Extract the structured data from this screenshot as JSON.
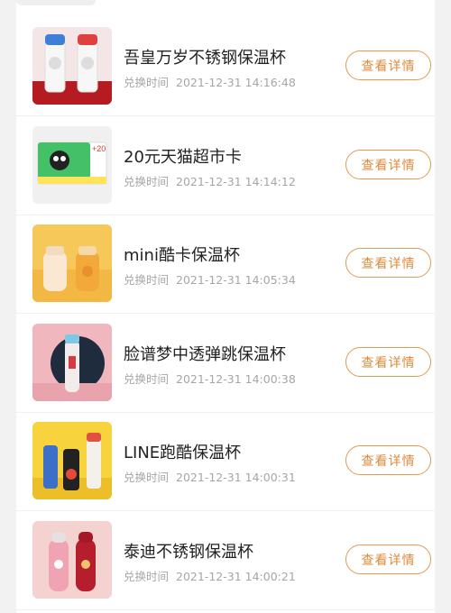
{
  "colors": {
    "accent": "#e09a52",
    "title": "#222222",
    "muted": "#a6a6a6"
  },
  "items": [
    {
      "title": "吾皇万岁不锈钢保温杯",
      "time_label": "兑换时间",
      "time": "2021-12-31 14:16:48",
      "button": "查看详情",
      "image_icon": "cat-thermos-image"
    },
    {
      "title": "20元天猫超市卡",
      "time_label": "兑换时间",
      "time": "2021-12-31 14:14:12",
      "button": "查看详情",
      "image_icon": "tmall-card-image",
      "card_badge": "+20"
    },
    {
      "title": "mini酷卡保温杯",
      "time_label": "兑换时间",
      "time": "2021-12-31 14:05:34",
      "button": "查看详情",
      "image_icon": "mini-bottle-image"
    },
    {
      "title": "脸谱梦中透弹跳保温杯",
      "time_label": "兑换时间",
      "time": "2021-12-31 14:00:38",
      "button": "查看详情",
      "image_icon": "opera-bottle-image"
    },
    {
      "title": "LINE跑酷保温杯",
      "time_label": "兑换时间",
      "time": "2021-12-31 14:00:31",
      "button": "查看详情",
      "image_icon": "line-bottle-image"
    },
    {
      "title": "泰迪不锈钢保温杯",
      "time_label": "兑换时间",
      "time": "2021-12-31 14:00:21",
      "button": "查看详情",
      "image_icon": "teddy-bottle-image"
    }
  ]
}
